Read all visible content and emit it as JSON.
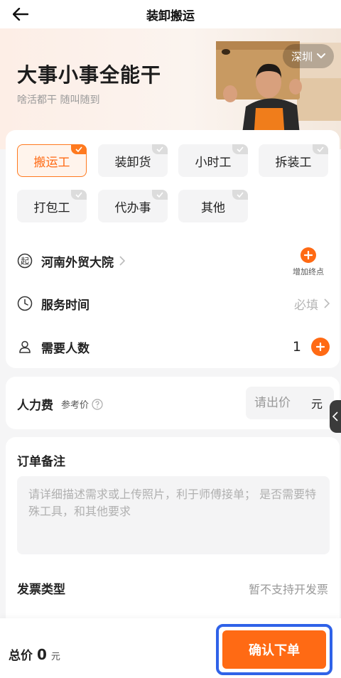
{
  "header": {
    "title": "装卸搬运",
    "back_icon": "arrow-left-icon"
  },
  "hero": {
    "title": "大事小事全能干",
    "subtitle": "啥活都干 随叫随到",
    "city": "深圳"
  },
  "service_types": [
    {
      "label": "搬运工",
      "selected": true
    },
    {
      "label": "装卸货",
      "selected": false
    },
    {
      "label": "小时工",
      "selected": false
    },
    {
      "label": "拆装工",
      "selected": false
    },
    {
      "label": "打包工",
      "selected": false
    },
    {
      "label": "代办事",
      "selected": false
    },
    {
      "label": "其他",
      "selected": false
    }
  ],
  "start": {
    "icon_char": "起",
    "address": "河南外贸大院",
    "add_end_label": "增加终点"
  },
  "service_time": {
    "label": "服务时间",
    "value": "必填"
  },
  "people": {
    "label": "需要人数",
    "count": "1"
  },
  "fee": {
    "label": "人力费",
    "ref_label": "参考价",
    "price_placeholder": "请出价",
    "unit": "元"
  },
  "notes": {
    "title": "订单备注",
    "placeholder": "请详细描述需求或上传照片，利于师傅接单； 是否需要特殊工具，和其他要求"
  },
  "invoice": {
    "label": "发票类型",
    "value": "暂不支持开发票"
  },
  "footer": {
    "total_label": "总价",
    "total_amount": "0",
    "total_unit": "元",
    "confirm_label": "确认下单"
  },
  "colors": {
    "accent": "#ff6a14",
    "highlight_border": "#2f62e8"
  }
}
